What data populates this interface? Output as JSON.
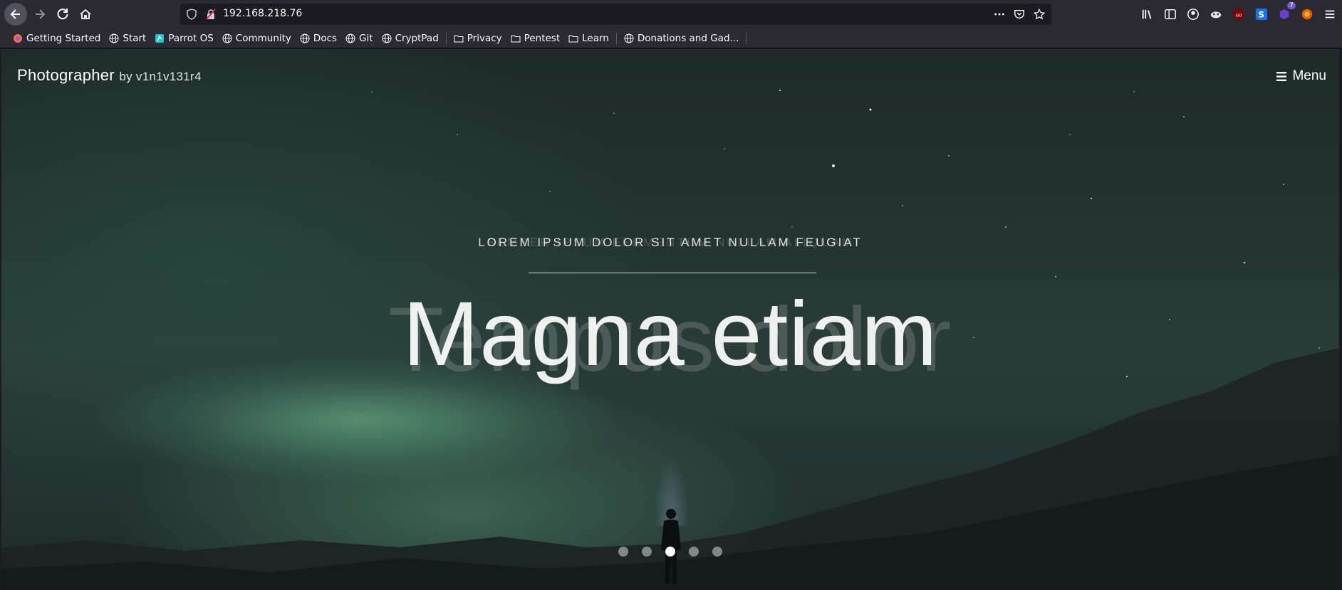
{
  "browser": {
    "url": "192.168.218.76",
    "extension_badge": "7",
    "bookmarks": [
      {
        "label": "Getting Started",
        "icon": "firefox-icon"
      },
      {
        "label": "Start",
        "icon": "globe-icon"
      },
      {
        "label": "Parrot OS",
        "icon": "parrot-icon"
      },
      {
        "label": "Community",
        "icon": "globe-icon"
      },
      {
        "label": "Docs",
        "icon": "globe-icon"
      },
      {
        "label": "Git",
        "icon": "globe-icon"
      },
      {
        "label": "CryptPad",
        "icon": "globe-icon"
      },
      {
        "label": "Privacy",
        "icon": "folder-icon"
      },
      {
        "label": "Pentest",
        "icon": "folder-icon"
      },
      {
        "label": "Learn",
        "icon": "folder-icon"
      },
      {
        "label": "Donations and Gad...",
        "icon": "globe-icon"
      }
    ]
  },
  "site": {
    "brand_name": "Photographer",
    "brand_by": "by v1n1v131r4",
    "menu_label": "Menu",
    "ghost_subtitle": "SEMPER IPSUM FERMENTUM NULLAM ALIQUAM",
    "hero_subtitle": "LOREM IPSUM DOLOR SIT AMET NULLAM FEUGIAT",
    "ghost_title": "Tempus dolor",
    "hero_title": "Magna etiam",
    "slider": {
      "count": 5,
      "active_index": 2
    }
  },
  "colors": {
    "toolbar": "#2b2a33",
    "urlbar": "#1c1b22",
    "active_dot": "#ffffff"
  }
}
